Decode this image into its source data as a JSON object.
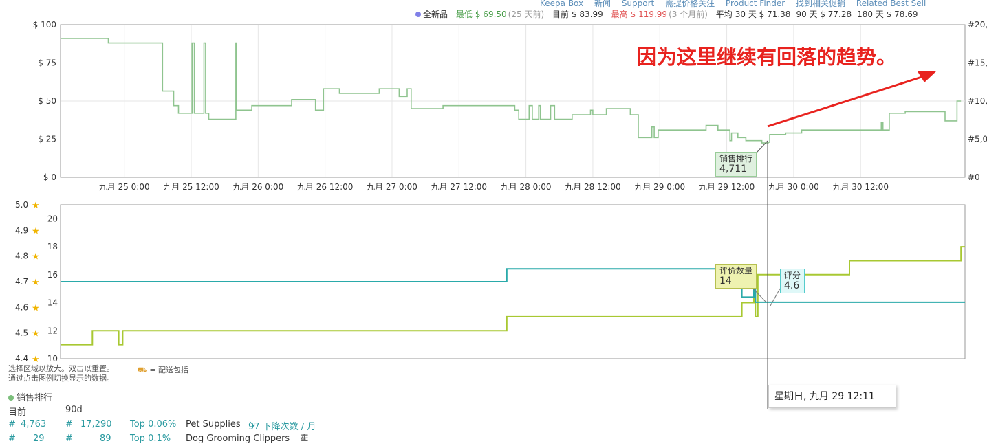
{
  "top_nav": [
    "Keepa Box",
    "新闻",
    "Support",
    "需提价格关注",
    "Product Finder",
    "找到相关促销",
    "Related Best Sell"
  ],
  "legend": {
    "new": "全新品",
    "lowest_label": "最低",
    "lowest_value": "$ 69.50",
    "lowest_when": "(25 天前)",
    "current_label": "目前",
    "current_value": "$ 83.99",
    "highest_label": "最高",
    "highest_value": "$ 119.99",
    "highest_when": "(3 个月前)",
    "avg_label": "平均",
    "avg30": "30 天 $ 71.38",
    "avg90": "90 天 $ 77.28",
    "avg180": "180 天 $ 78.69"
  },
  "annotation": "因为这里继续有回落的趋势。",
  "tooltips": {
    "rank_label": "销售排行",
    "rank_value": "4,711",
    "count_label": "评价数量",
    "count_value": "14",
    "rating_label": "评分",
    "rating_value": "4.6"
  },
  "date_box": "星期日, 九月 29 12:11",
  "hints": [
    "选择区域以放大。双击以重置。",
    "通过点击图例切换显示的数据。"
  ],
  "delivery_hint": "= 配送包括",
  "info": {
    "section": "销售排行",
    "col_current": "目前",
    "col_90d": "90d",
    "row1": {
      "hash1": "#",
      "current": "4,763",
      "hash2": "#",
      "d90": "17,290",
      "top": "Top 0.06%",
      "category": "Pet Supplies",
      "drops": "97 下降次数 / 月"
    },
    "row2": {
      "hash1": "#",
      "current": "29",
      "hash2": "#",
      "d90": "89",
      "top": "Top 0.1%",
      "category": "Dog Grooming Clippers",
      "sub": "4"
    }
  },
  "chart_data": [
    {
      "type": "line",
      "name": "price-rank-chart",
      "x_ticks": [
        "九月 25 0:00",
        "九月 25 12:00",
        "九月 26 0:00",
        "九月 26 12:00",
        "九月 27 0:00",
        "九月 27 12:00",
        "九月 28 0:00",
        "九月 28 12:00",
        "九月 29 0:00",
        "九月 29 12:00",
        "九月 30 0:00",
        "九月 30 12:00"
      ],
      "y_left_ticks": [
        "$ 0",
        "$ 25",
        "$ 50",
        "$ 75",
        "$ 100"
      ],
      "y_right_ticks": [
        "#0",
        "#5,0",
        "#10,",
        "#15,",
        "#20,"
      ],
      "ylim_left": [
        0,
        100
      ],
      "ylim_right": [
        0,
        20000
      ],
      "x_range_hours": [
        -4,
        89
      ],
      "series": [
        {
          "color": "#8fc48f",
          "points": [
            [
              -4,
              18200
            ],
            [
              2,
              18200
            ],
            [
              2,
              17600
            ],
            [
              8.8,
              17600
            ],
            [
              8.8,
              11300
            ],
            [
              10.2,
              11300
            ],
            [
              10.2,
              9400
            ],
            [
              10.8,
              9400
            ],
            [
              10.8,
              8400
            ],
            [
              12.5,
              8400
            ],
            [
              12.5,
              17600
            ],
            [
              12.8,
              17600
            ],
            [
              12.8,
              8400
            ],
            [
              14,
              8400
            ],
            [
              14,
              17600
            ],
            [
              14.2,
              17600
            ],
            [
              14.2,
              8400
            ],
            [
              14.6,
              8400
            ],
            [
              14.6,
              7600
            ],
            [
              18,
              7600
            ],
            [
              18,
              17600
            ],
            [
              18.1,
              17600
            ],
            [
              18.1,
              8800
            ],
            [
              20,
              8800
            ],
            [
              20,
              9400
            ],
            [
              25,
              9400
            ],
            [
              25,
              10200
            ],
            [
              28,
              10200
            ],
            [
              28,
              8800
            ],
            [
              29,
              8800
            ],
            [
              29,
              11600
            ],
            [
              31,
              11600
            ],
            [
              31,
              11000
            ],
            [
              36,
              11000
            ],
            [
              36,
              11600
            ],
            [
              38.5,
              11600
            ],
            [
              38.5,
              10600
            ],
            [
              39.5,
              10600
            ],
            [
              39.5,
              11600
            ],
            [
              40,
              11600
            ],
            [
              40,
              9000
            ],
            [
              41,
              9000
            ],
            [
              41,
              9000
            ],
            [
              44,
              9000
            ],
            [
              44,
              9400
            ],
            [
              51,
              9400
            ],
            [
              51,
              9400
            ],
            [
              53,
              9400
            ],
            [
              53,
              8800
            ],
            [
              53.5,
              8800
            ],
            [
              53.5,
              7600
            ],
            [
              54.8,
              7600
            ],
            [
              54.8,
              9400
            ],
            [
              55.2,
              9400
            ],
            [
              55.2,
              7600
            ],
            [
              56,
              7600
            ],
            [
              56,
              9400
            ],
            [
              56.2,
              9400
            ],
            [
              56.2,
              7600
            ],
            [
              57.5,
              7600
            ],
            [
              57.5,
              9400
            ],
            [
              58,
              9400
            ],
            [
              58,
              7600
            ],
            [
              60.2,
              7600
            ],
            [
              60.2,
              8200
            ],
            [
              62.5,
              8200
            ],
            [
              62.5,
              8800
            ],
            [
              62.8,
              8800
            ],
            [
              62.8,
              8200
            ],
            [
              64.5,
              8200
            ],
            [
              64.5,
              9000
            ],
            [
              67.5,
              9000
            ],
            [
              67.5,
              8200
            ],
            [
              68.5,
              8200
            ],
            [
              68.5,
              5200
            ],
            [
              70.2,
              5200
            ],
            [
              70.2,
              6600
            ],
            [
              70.5,
              6600
            ],
            [
              70.5,
              5200
            ],
            [
              71,
              5200
            ],
            [
              71,
              6200
            ],
            [
              75,
              6200
            ],
            [
              75,
              6200
            ],
            [
              77,
              6200
            ],
            [
              77,
              6800
            ],
            [
              78.5,
              6800
            ],
            [
              78.5,
              6200
            ],
            [
              80,
              6200
            ],
            [
              80,
              4800
            ],
            [
              80.2,
              4800
            ],
            [
              80.2,
              5800
            ],
            [
              81,
              5800
            ],
            [
              81,
              5200
            ],
            [
              82,
              5200
            ],
            [
              82,
              4800
            ],
            [
              84,
              4800
            ],
            [
              84,
              4500
            ],
            [
              84.8,
              4500
            ],
            [
              84.8,
              4600
            ],
            [
              85,
              4600
            ],
            [
              85,
              5600
            ],
            [
              87,
              5600
            ],
            [
              87,
              5800
            ],
            [
              89,
              5800
            ],
            [
              89,
              6200
            ],
            [
              90,
              6200
            ],
            [
              90,
              6200
            ],
            [
              95,
              6200
            ],
            [
              95,
              6200
            ],
            [
              99,
              6200
            ],
            [
              99,
              7200
            ],
            [
              99.2,
              7200
            ],
            [
              99.2,
              6200
            ],
            [
              100,
              6200
            ],
            [
              100,
              8400
            ],
            [
              100,
              8400
            ],
            [
              102,
              8400
            ],
            [
              102,
              8600
            ],
            [
              107,
              8600
            ],
            [
              107,
              7400
            ],
            [
              108.5,
              7400
            ],
            [
              108.5,
              10000
            ],
            [
              109,
              10000
            ]
          ]
        }
      ]
    },
    {
      "type": "line",
      "name": "rating-count-chart",
      "y_left_ticks": [
        "4.4",
        "4.5",
        "4.6",
        "4.7",
        "4.8",
        "4.9",
        "5.0"
      ],
      "y_right_ticks": [
        "10",
        "12",
        "14",
        "16",
        "18",
        "20"
      ],
      "ylim_left": [
        4.4,
        5.0
      ],
      "ylim_right": [
        10,
        21
      ],
      "series": [
        {
          "label": "评价数量",
          "color": "#a8c832",
          "points": [
            [
              -4,
              11
            ],
            [
              0,
              11
            ],
            [
              0,
              12
            ],
            [
              3.3,
              12
            ],
            [
              3.3,
              11
            ],
            [
              3.8,
              11
            ],
            [
              3.8,
              12
            ],
            [
              52,
              12
            ],
            [
              52,
              13
            ],
            [
              81.5,
              13
            ],
            [
              81.5,
              14
            ],
            [
              83,
              14
            ],
            [
              83,
              14.6
            ],
            [
              83.2,
              14.6
            ],
            [
              83.2,
              13
            ],
            [
              83.5,
              13
            ],
            [
              83.5,
              16
            ],
            [
              95,
              16
            ],
            [
              95,
              17
            ],
            [
              109,
              17
            ],
            [
              109,
              18
            ],
            [
              109.5,
              18
            ]
          ]
        },
        {
          "label": "评分",
          "color": "#2aaaaa",
          "points": [
            [
              -4,
              4.7
            ],
            [
              52,
              4.7
            ],
            [
              52,
              4.75
            ],
            [
              81.5,
              4.75
            ],
            [
              81.5,
              4.64
            ],
            [
              83,
              4.64
            ],
            [
              83,
              4.74
            ],
            [
              83.2,
              4.74
            ],
            [
              83.2,
              4.62
            ],
            [
              109.5,
              4.62
            ]
          ]
        }
      ]
    }
  ]
}
